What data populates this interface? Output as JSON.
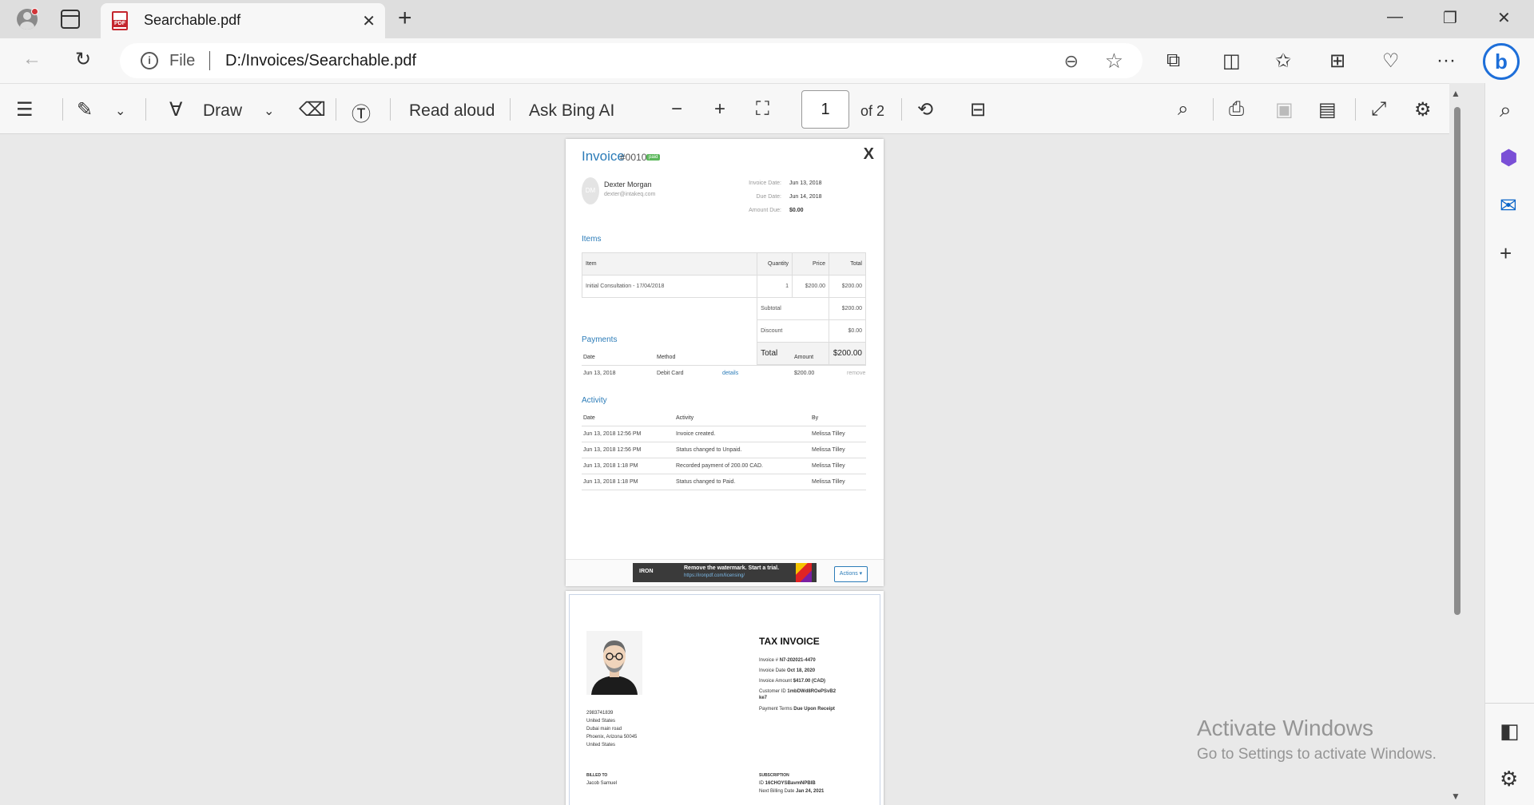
{
  "browser": {
    "tab_title": "Searchable.pdf",
    "url_scheme": "File",
    "url": "D:/Invoices/Searchable.pdf"
  },
  "pdf_toolbar": {
    "draw_label": "Draw",
    "read_aloud_label": "Read aloud",
    "ask_bing_label": "Ask Bing AI",
    "page_number": "1",
    "page_total": "of 2"
  },
  "page1": {
    "title": "Invoice",
    "number": "#0010",
    "status_badge": "paid",
    "close": "X",
    "avatar_initials": "DM",
    "customer_name": "Dexter Morgan",
    "customer_email": "dexter@intakeq.com",
    "invoice_date_label": "Invoice Date:",
    "invoice_date": "Jun 13, 2018",
    "due_date_label": "Due Date:",
    "due_date": "Jun 14, 2018",
    "amount_due_label": "Amount Due:",
    "amount_due": "$0.00",
    "items_heading": "Items",
    "items_headers": [
      "Item",
      "Quantity",
      "Price",
      "Total"
    ],
    "items": [
      {
        "item": "Initial Consultation - 17/04/2018",
        "quantity": "1",
        "price": "$200.00",
        "total": "$200.00"
      }
    ],
    "subtotal_label": "Subtotal",
    "subtotal": "$200.00",
    "discount_label": "Discount",
    "discount": "$0.00",
    "total_label": "Total",
    "total": "$200.00",
    "payments_heading": "Payments",
    "payments_headers": [
      "Date",
      "Method",
      "Amount"
    ],
    "payments": [
      {
        "date": "Jun 13, 2018",
        "method": "Debit Card",
        "details": "details",
        "amount": "$200.00",
        "remove": "remove"
      }
    ],
    "activity_heading": "Activity",
    "activity_headers": [
      "Date",
      "Activity",
      "By"
    ],
    "activity": [
      {
        "date": "Jun 13, 2018 12:56 PM",
        "activity": "Invoice created.",
        "by": "Melissa Tilley"
      },
      {
        "date": "Jun 13, 2018 12:56 PM",
        "activity": "Status changed to Unpaid.",
        "by": "Melissa Tilley"
      },
      {
        "date": "Jun 13, 2018 1:18 PM",
        "activity": "Recorded payment of 200.00 CAD.",
        "by": "Melissa Tilley"
      },
      {
        "date": "Jun 13, 2018 1:18 PM",
        "activity": "Status changed to Paid.",
        "by": "Melissa Tilley"
      }
    ],
    "watermark_brand": "IRON",
    "watermark_text": "Remove the watermark. Start a trial.",
    "watermark_link": "https://ironpdf.com/licensing/",
    "actions_label": "Actions ▾"
  },
  "page2": {
    "title": "TAX INVOICE",
    "invoice_no_label": "Invoice #",
    "invoice_no": "N7-202021-4470",
    "invoice_date_label": "Invoice Date",
    "invoice_date": "Oct 18, 2020",
    "invoice_amount_label": "Invoice Amount",
    "invoice_amount": "$417.00 (CAD)",
    "customer_id_label": "Customer ID",
    "customer_id_1": "1mbDWd8ROePSvB2",
    "customer_id_2": "ke7",
    "payment_terms_label": "Payment Terms",
    "payment_terms": "Due Upon Receipt",
    "address": [
      "2983741839",
      "United States",
      "Dubai main road",
      "Phoenix, Arizona 50045",
      "United States"
    ],
    "billed_to_label": "BILLED TO",
    "billed_to": "Jacob Samuel",
    "subscription_label": "SUBSCRIPTION",
    "subscription_id_label": "ID",
    "subscription_id": "16CHOYSBavmNPBIB",
    "next_billing_label": "Next Billing Date",
    "next_billing": "Jan 24, 2021"
  },
  "system": {
    "activate_title": "Activate Windows",
    "activate_sub": "Go to Settings to activate Windows."
  }
}
